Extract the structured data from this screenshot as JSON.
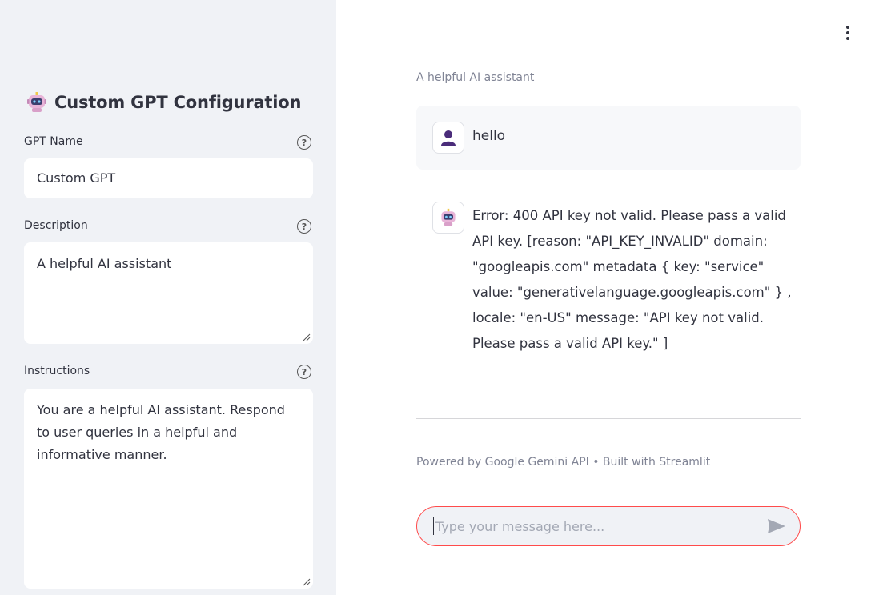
{
  "sidebar": {
    "title": "Custom GPT Configuration",
    "title_icon": "robot-icon",
    "gpt_name": {
      "label": "GPT Name",
      "value": "Custom GPT",
      "help_icon": "help-circle-icon"
    },
    "description": {
      "label": "Description",
      "value": "A helpful AI assistant",
      "help_icon": "help-circle-icon"
    },
    "instructions": {
      "label": "Instructions",
      "value": "You are a helpful AI assistant. Respond to user queries in a helpful and informative manner.",
      "help_icon": "help-circle-icon"
    }
  },
  "header": {
    "menu_icon": "kebab-menu-icon"
  },
  "main": {
    "caption": "A helpful AI assistant",
    "messages": [
      {
        "role": "user",
        "avatar_icon": "user-icon",
        "text": "hello"
      },
      {
        "role": "assistant",
        "avatar_icon": "robot-icon",
        "text": "Error: 400 API key not valid. Please pass a valid API key. [reason: \"API_KEY_INVALID\" domain: \"googleapis.com\" metadata { key: \"service\" value: \"generativelanguage.googleapis.com\" } , locale: \"en-US\" message: \"API key not valid. Please pass a valid API key.\" ]"
      }
    ],
    "footer": "Powered by Google Gemini API • Built with Streamlit",
    "chat_input": {
      "placeholder": "Type your message here...",
      "value": "",
      "send_icon": "send-icon"
    }
  },
  "colors": {
    "sidebar_bg": "#f0f2f6",
    "accent": "#ff4b4b",
    "text": "#31333f",
    "muted": "#808495",
    "user_avatar": "#4a2c7a"
  }
}
